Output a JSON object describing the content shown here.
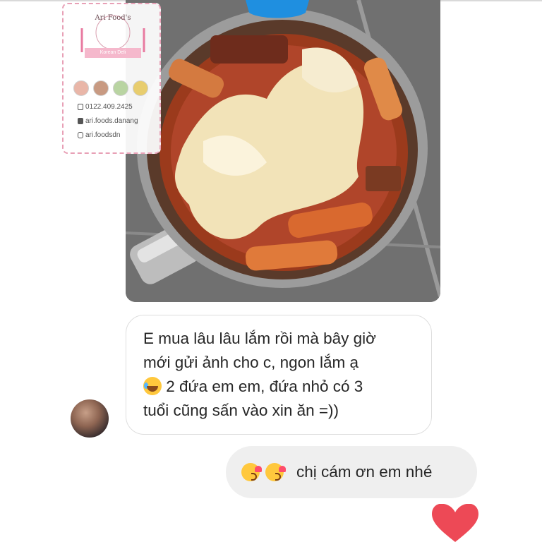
{
  "photo_message": {
    "alt_icon": "food-photo",
    "watermark": {
      "brand_name": "Ari Food's",
      "brand_subtitle": "Korean Deli",
      "phone": "0122.409.2425",
      "facebook": "ari.foods.danang",
      "instagram": "ari.foodsdn"
    }
  },
  "incoming_message": {
    "lines": [
      "E mua lâu lâu lắm rồi mà bây giờ",
      "mới gửi ảnh cho c, ngon lắm ạ",
      " 2 đứa em em, đứa nhỏ có 3",
      "tuổi cũng sấn vào xin ăn =))"
    ],
    "emoji_icon": "face-with-tears-of-joy"
  },
  "outgoing_message": {
    "text": "chị cám ơn em nhé",
    "emoji_icons": [
      "face-blowing-kiss",
      "face-blowing-kiss"
    ]
  },
  "reaction": {
    "icon": "heart",
    "color": "#ed4956"
  },
  "colors": {
    "incoming_bubble_bg": "#ffffff",
    "outgoing_bubble_bg": "#efefef",
    "text": "#262626"
  }
}
